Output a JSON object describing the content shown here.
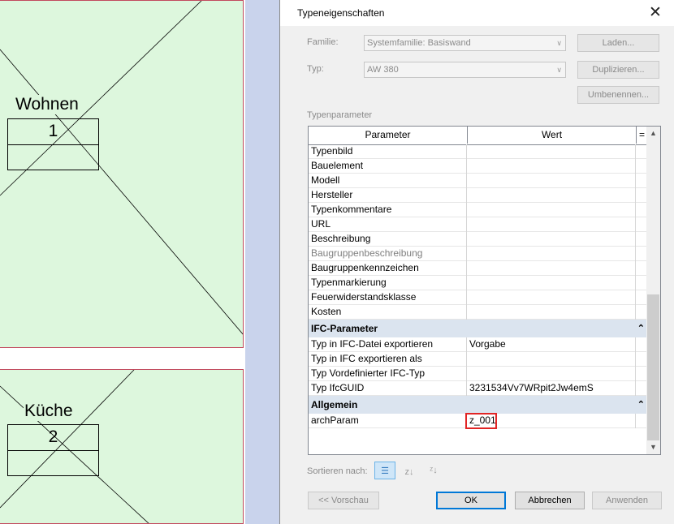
{
  "canvas": {
    "rooms": [
      {
        "name": "Wohnen",
        "number": "1"
      },
      {
        "name": "Küche",
        "number": "2"
      }
    ]
  },
  "dialog": {
    "title": "Typeneigenschaften",
    "close_glyph": "✕",
    "familie_label": "Familie:",
    "familie_value": "Systemfamilie: Basiswand",
    "typ_label": "Typ:",
    "typ_value": "AW 380",
    "laden": "Laden...",
    "duplizieren": "Duplizieren...",
    "umbenennen": "Umbenennen...",
    "typenparameter": "Typenparameter",
    "col_parameter": "Parameter",
    "col_wert": "Wert",
    "col_eq": "=",
    "rows_a": [
      {
        "p": "Typenbild",
        "w": "",
        "dim": false
      },
      {
        "p": "Bauelement",
        "w": "",
        "dim": false
      },
      {
        "p": "Modell",
        "w": "",
        "dim": false
      },
      {
        "p": "Hersteller",
        "w": "",
        "dim": false
      },
      {
        "p": "Typenkommentare",
        "w": "",
        "dim": false
      },
      {
        "p": "URL",
        "w": "",
        "dim": false
      },
      {
        "p": "Beschreibung",
        "w": "",
        "dim": false
      },
      {
        "p": "Baugruppenbeschreibung",
        "w": "",
        "dim": true
      },
      {
        "p": "Baugruppenkennzeichen",
        "w": "",
        "dim": false
      },
      {
        "p": "Typenmarkierung",
        "w": "",
        "dim": false
      },
      {
        "p": "Feuerwiderstandsklasse",
        "w": "",
        "dim": false
      },
      {
        "p": "Kosten",
        "w": "",
        "dim": false
      }
    ],
    "group_ifc": "IFC-Parameter",
    "rows_ifc": [
      {
        "p": "Typ in IFC-Datei exportieren",
        "w": "Vorgabe"
      },
      {
        "p": "Typ in IFC exportieren als",
        "w": ""
      },
      {
        "p": "Typ Vordefinierter IFC-Typ",
        "w": ""
      },
      {
        "p": "Typ IfcGUID",
        "w": "3231534Vv7WRpit2Jw4emS"
      }
    ],
    "group_allgemein": "Allgemein",
    "rows_allg": [
      {
        "p": "archParam",
        "w": "z_001"
      }
    ],
    "collapse_glyph": "⌃",
    "sortieren": "Sortieren nach:",
    "vorschau": "<< Vorschau",
    "ok": "OK",
    "abbrechen": "Abbrechen",
    "anwenden": "Anwenden"
  }
}
